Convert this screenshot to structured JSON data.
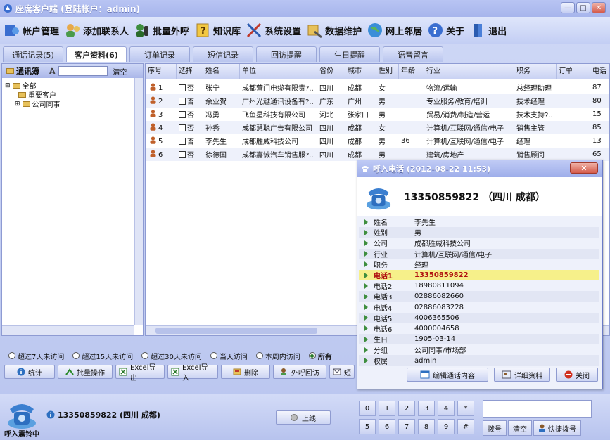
{
  "window": {
    "title": "座席客户端 (登陆帐户：admin)",
    "controls": [
      "—",
      "□",
      "✕"
    ]
  },
  "toolbar": [
    {
      "label": "帐户管理",
      "icon": "account-icon"
    },
    {
      "label": "添加联系人",
      "icon": "add-contact-icon"
    },
    {
      "label": "批量外呼",
      "icon": "batch-call-icon"
    },
    {
      "label": "知识库",
      "icon": "knowledge-icon"
    },
    {
      "label": "系统设置",
      "icon": "settings-icon"
    },
    {
      "label": "数据维护",
      "icon": "data-icon"
    },
    {
      "label": "网上邻居",
      "icon": "network-icon"
    },
    {
      "label": "关于",
      "icon": "help-icon"
    },
    {
      "label": "退出",
      "icon": "exit-icon"
    }
  ],
  "tabs": [
    {
      "label": "通话记录(5)"
    },
    {
      "label": "客户资料(6)",
      "active": true
    },
    {
      "label": "订单记录"
    },
    {
      "label": "短信记录"
    },
    {
      "label": "回访提醒"
    },
    {
      "label": "生日提醒"
    },
    {
      "label": "语音留言"
    }
  ],
  "left_panel": {
    "title": "通讯簿",
    "find_glyph": "Ä",
    "clear_label": "清空",
    "tree_root": "全部",
    "tree_children": [
      "重要客户",
      "公司同事"
    ]
  },
  "table": {
    "columns": [
      "序号",
      "选择",
      "姓名",
      "单位",
      "省份",
      "城市",
      "性别",
      "年龄",
      "行业",
      "职务",
      "订单",
      "电话"
    ],
    "rows": [
      {
        "no": "1",
        "sel": "否",
        "name": "张宁",
        "org": "成都营门电缆有限责?..",
        "prov": "四川",
        "city": "成都",
        "sex": "女",
        "age": "",
        "ind": "物流/运输",
        "job": "总经理助理",
        "order": "",
        "tel": "87"
      },
      {
        "no": "2",
        "sel": "否",
        "name": "余业贺",
        "org": "广州光越通讯设备有?..",
        "prov": "广东",
        "city": "广州",
        "sex": "男",
        "age": "",
        "ind": "专业服务/教育/培训",
        "job": "技术经理",
        "order": "",
        "tel": "80"
      },
      {
        "no": "3",
        "sel": "否",
        "name": "冯勇",
        "org": "飞鱼星科技有限公司",
        "prov": "河北",
        "city": "张家口",
        "sex": "男",
        "age": "",
        "ind": "贸易/消费/制造/营运",
        "job": "技术支持?..",
        "order": "",
        "tel": "15"
      },
      {
        "no": "4",
        "sel": "否",
        "name": "孙秀",
        "org": "成都慧聪广告有限公司",
        "prov": "四川",
        "city": "成都",
        "sex": "女",
        "age": "",
        "ind": "计算机/互联网/通信/电子",
        "job": "销售主管",
        "order": "",
        "tel": "85"
      },
      {
        "no": "5",
        "sel": "否",
        "name": "李先生",
        "org": "成都胜威科技公司",
        "prov": "四川",
        "city": "成都",
        "sex": "男",
        "age": "36",
        "ind": "计算机/互联网/通信/电子",
        "job": "经理",
        "order": "",
        "tel": "13"
      },
      {
        "no": "6",
        "sel": "否",
        "name": "徐德国",
        "org": "成都嘉诚汽车销售服?..",
        "prov": "四川",
        "city": "成都",
        "sex": "男",
        "age": "",
        "ind": "建筑/房地产",
        "job": "销售顾问",
        "order": "",
        "tel": "65"
      }
    ]
  },
  "radios": [
    {
      "label": "超过7天未访问"
    },
    {
      "label": "超过15天未访问"
    },
    {
      "label": "超过30天未访问"
    },
    {
      "label": "当天访问"
    },
    {
      "label": "本周内访问"
    },
    {
      "label": "所有",
      "checked": true
    }
  ],
  "actions": [
    {
      "label": "统计",
      "icon": "info-icon"
    },
    {
      "label": "批量操作",
      "icon": "batch-icon"
    },
    {
      "label": "Excel导出",
      "icon": "excel-export-icon"
    },
    {
      "label": "Excel导入",
      "icon": "excel-import-icon"
    },
    {
      "label": "删除",
      "icon": "delete-icon"
    },
    {
      "label": "外呼回访",
      "icon": "callback-icon"
    },
    {
      "label": "短",
      "icon": "sms-icon"
    }
  ],
  "popup": {
    "title": "呼入电话 (2012-08-22 11:53)",
    "close_glyph": "✕",
    "caller": "13350859822  （四川 成都）",
    "rows": [
      {
        "label": "姓名",
        "value": "李先生"
      },
      {
        "label": "姓别",
        "value": "男"
      },
      {
        "label": "公司",
        "value": "成都胜威科技公司"
      },
      {
        "label": "行业",
        "value": "计算机/互联网/通信/电子"
      },
      {
        "label": "职务",
        "value": "经理"
      },
      {
        "label": "电话1",
        "value": "13350859822",
        "highlight": true
      },
      {
        "label": "电话2",
        "value": "18980811094"
      },
      {
        "label": "电话3",
        "value": "02886082660"
      },
      {
        "label": "电话4",
        "value": "02886083228"
      },
      {
        "label": "电话5",
        "value": "4006365506"
      },
      {
        "label": "电话6",
        "value": "4000004658"
      },
      {
        "label": "生日",
        "value": "1905-03-14"
      },
      {
        "label": "分组",
        "value": "公司同事/市场部"
      },
      {
        "label": "权属",
        "value": "admin"
      }
    ],
    "buttons": {
      "edit": "编辑通话内容",
      "detail": "详细资料",
      "close": "关闭"
    }
  },
  "bottom": {
    "ring_status": "呼入震铃中",
    "caller": "13350859822 (四川 成都)",
    "online": "上线",
    "keys": [
      "0",
      "1",
      "2",
      "3",
      "4",
      "*",
      "5",
      "6",
      "7",
      "8",
      "9",
      "#"
    ],
    "dial_value": "",
    "dial": "拨号",
    "clear": "清空",
    "speed": "快捷拨号"
  },
  "colors": {
    "accent": "#a9b6e9",
    "highlight_row": "#f6f08a",
    "highlight_text": "#b01010"
  }
}
